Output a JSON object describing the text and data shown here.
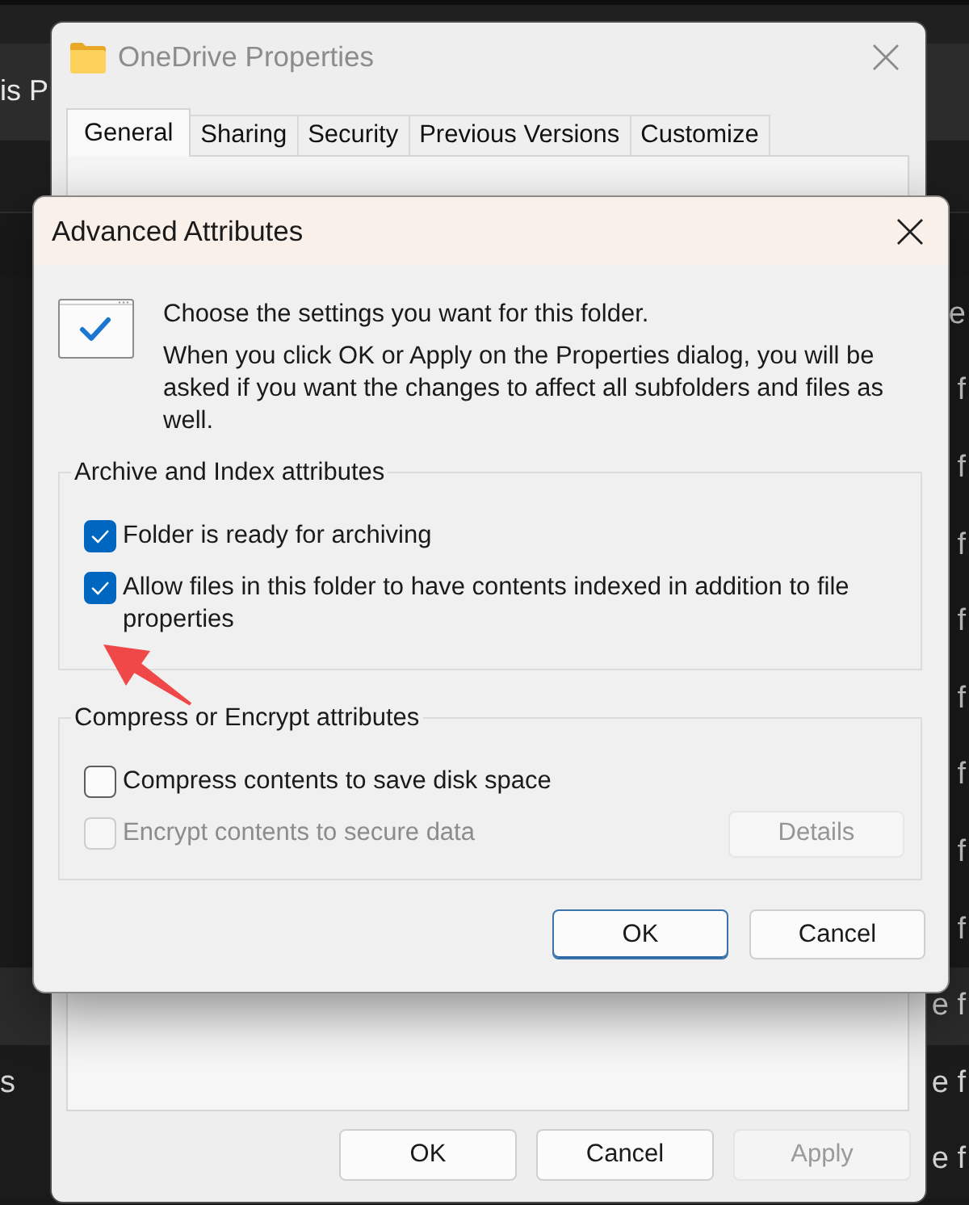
{
  "explorer": {
    "header_text": "is P",
    "rows": [
      {
        "right_text": "e",
        "selected": false
      },
      {
        "right_text": "f",
        "selected": false
      },
      {
        "right_text": "f",
        "selected": false
      },
      {
        "right_text": "f",
        "selected": false
      },
      {
        "right_text": "f",
        "selected": false
      },
      {
        "right_text": "f",
        "selected": false
      },
      {
        "right_text": "f",
        "selected": false
      },
      {
        "right_text": "f",
        "selected": false
      },
      {
        "right_text": "f",
        "selected": false
      },
      {
        "right_text": "e f",
        "selected": true
      },
      {
        "left_text": "s",
        "right_text": "e f",
        "selected": false
      },
      {
        "right_text": "e f",
        "selected": false
      }
    ]
  },
  "properties_window": {
    "title": "OneDrive Properties",
    "active": false,
    "tabs": [
      {
        "label": "General",
        "selected": true
      },
      {
        "label": "Sharing",
        "selected": false
      },
      {
        "label": "Security",
        "selected": false
      },
      {
        "label": "Previous Versions",
        "selected": false
      },
      {
        "label": "Customize",
        "selected": false
      }
    ],
    "buttons": [
      {
        "label": "OK",
        "disabled": false
      },
      {
        "label": "Cancel",
        "disabled": false
      },
      {
        "label": "Apply",
        "disabled": true
      }
    ]
  },
  "advanced_dialog": {
    "title": "Advanced Attributes",
    "intro": "Choose the settings you want for this folder.",
    "note": "When you click OK or Apply on the Properties dialog, you will be asked if you want the changes to affect all subfolders and files as well.",
    "groups": [
      {
        "title": "Archive and Index attributes",
        "options": [
          {
            "label": "Folder is ready for archiving",
            "checked": true,
            "disabled": false
          },
          {
            "label": "Allow files in this folder to have contents indexed in addition to file properties",
            "checked": true,
            "disabled": false
          }
        ]
      },
      {
        "title": "Compress or Encrypt attributes",
        "options": [
          {
            "label": "Compress contents to save disk space",
            "checked": false,
            "disabled": false
          },
          {
            "label": "Encrypt contents to secure data",
            "checked": false,
            "disabled": true,
            "button": {
              "label": "Details",
              "disabled": true
            }
          }
        ]
      }
    ],
    "buttons": [
      {
        "label": "OK",
        "default": true
      },
      {
        "label": "Cancel",
        "default": false
      }
    ]
  },
  "annotations": [
    {
      "kind": "arrow"
    }
  ]
}
